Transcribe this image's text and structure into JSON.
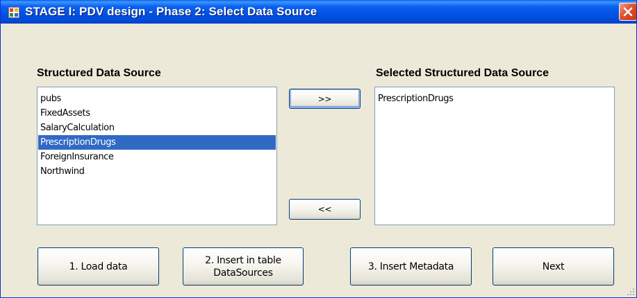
{
  "window": {
    "title": "STAGE I:  PDV design - Phase 2: Select Data Source"
  },
  "left_panel": {
    "label": "Structured Data Source",
    "items": [
      "pubs",
      "FixedAssets",
      "SalaryCalculation",
      "PrescriptionDrugs",
      "ForeignInsurance",
      "Northwind"
    ],
    "selected_item": "PrescriptionDrugs"
  },
  "right_panel": {
    "label": "Selected Structured Data Source",
    "items": [
      "PrescriptionDrugs"
    ]
  },
  "transfer": {
    "add_label": ">>",
    "remove_label": "<<"
  },
  "actions": {
    "load_label": "1. Load data",
    "insert_table_line1": "2. Insert in table",
    "insert_table_line2": "DataSources",
    "insert_metadata_label": "3. Insert Metadata",
    "next_label": "Next"
  },
  "colors": {
    "selection": "#316ac5",
    "title_bar": "#0251e2",
    "close_button": "#e0512d",
    "dialog_face": "#ece9d8"
  },
  "icons": {
    "app": "window-app-icon",
    "close": "close-icon",
    "grip": "resize-grip-icon"
  }
}
